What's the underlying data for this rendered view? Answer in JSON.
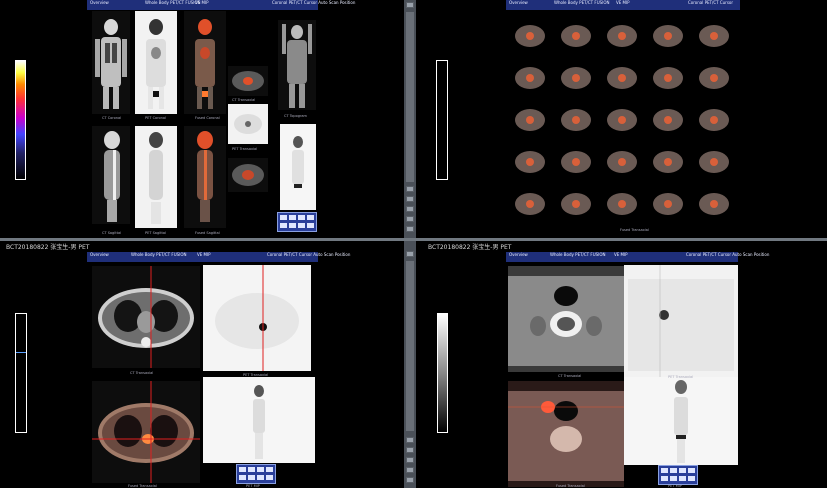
{
  "top_left": {
    "header": {
      "col1": "Overview",
      "col2": "Whole Body PET/CT\nFUSION",
      "col3": "VE\nMIP",
      "col4": "Coronal PET/CT Cursor\nAuto Scan Position"
    },
    "labels": {
      "ct_coronal": "CT Coronal",
      "pet_coronal": "PET Coronal",
      "fused_coronal": "Fused Coronal",
      "ct_sagittal": "CT Sagittal",
      "pet_sagittal": "PET Sagittal",
      "fused_sagittal": "Fused Sagittal",
      "axial_fused": "CT Transaxial",
      "axial_pet": "PET Transaxial",
      "mip": "PET MIP",
      "scout": "CT Topogram"
    }
  },
  "top_right": {
    "header": {
      "col1": "Overview",
      "col2": "Whole Body PET/CT\nFUSION",
      "col3": "VE\nMIP",
      "col4": "Coronal PET/CT Cursor"
    },
    "footer_label": "Fused Transaxial"
  },
  "bottom_left": {
    "patient": "BCT20180822 张宝生-男 PET",
    "header": {
      "col1": "Overview",
      "col2": "Whole Body PET/CT\nFUSION",
      "col3": "VE\nMIP",
      "col4": "Coronal PET/CT Cursor\nAuto Scan Position"
    },
    "labels": {
      "ct": "CT Transaxial",
      "pet": "PET Transaxial",
      "fused": "Fused Transaxial",
      "mip": "PET MIP"
    }
  },
  "bottom_right": {
    "patient": "BCT20180822 张宝生-男 PET",
    "header": {
      "col1": "Overview",
      "col2": "Whole Body PET/CT\nFUSION",
      "col3": "VE\nMIP",
      "col4": "Coronal PET/CT Cursor\nAuto Scan Position"
    },
    "labels": {
      "ct": "CT Transaxial",
      "pet": "PET Transaxial",
      "fused": "Fused Transaxial",
      "mip": "PET MIP"
    }
  },
  "colors": {
    "header_bg": "#1f2f7a",
    "pet_hot": "#e0502a",
    "separator": "#808890",
    "toolbar_bg": "#2a3f9a"
  }
}
